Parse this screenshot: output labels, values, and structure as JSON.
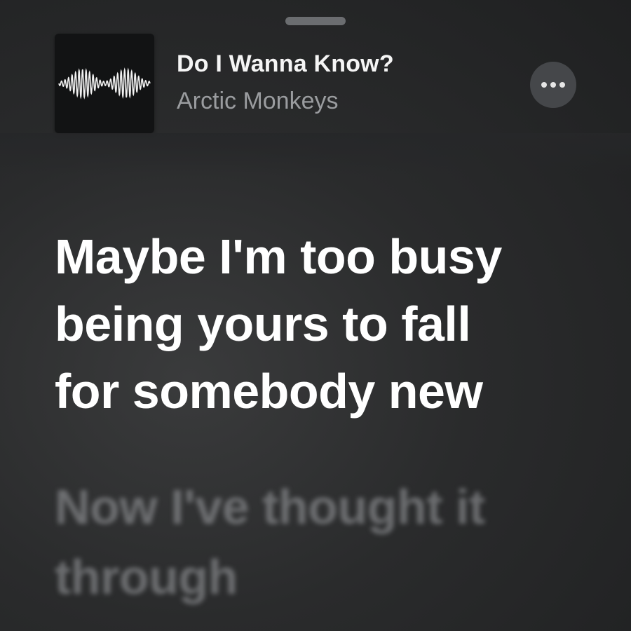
{
  "now_playing": {
    "title": "Do I Wanna Know?",
    "artist": "Arctic Monkeys",
    "artwork_icon": "sound-wave-artwork",
    "more_icon": "ellipsis-icon"
  },
  "lyrics": {
    "current_lines": [
      "Maybe I'm too busy",
      "being yours to fall",
      "for somebody new"
    ],
    "next_lines": [
      "Now I've thought it",
      "through"
    ]
  },
  "colors": {
    "background": "#2a2b2c",
    "active_lyric": "#ffffff",
    "artist_text": "#9a9c9f",
    "button_bg": "#45474a"
  }
}
